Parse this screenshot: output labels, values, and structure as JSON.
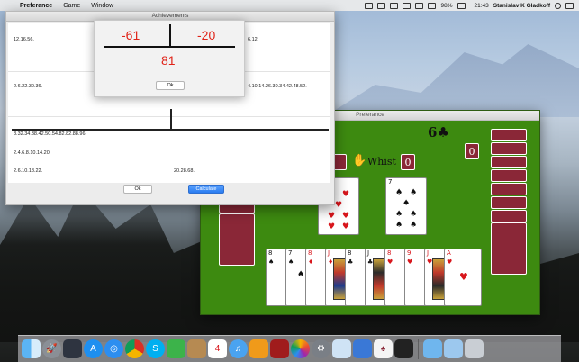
{
  "menubar": {
    "apple": "",
    "app_name": "Preferance",
    "items": [
      "Game",
      "Window"
    ],
    "battery": "98%",
    "flag": "",
    "time": "21:43",
    "user": "Stanislav K Gladkoff"
  },
  "achievements": {
    "title": "Achievements",
    "rows": [
      {
        "left": "12.16.56.",
        "right": "6.12."
      },
      {
        "left": "2.6.22.30.36.",
        "right": "4.10.14.26.30.34.42.48.52."
      },
      {
        "left": "8.32.34.38.42.50.54.82.82.88.96.",
        "right": ""
      },
      {
        "left": "2.4.6.8.10.14.20.",
        "right": ""
      },
      {
        "left": "2.6.10.18.22.",
        "right": "20.28.68."
      }
    ],
    "ok_label": "Ok",
    "calculate_label": "Calculate"
  },
  "score_popup": {
    "left": "-61",
    "right": "-20",
    "total": "81",
    "ok_label": "Ok"
  },
  "game": {
    "title": "Preferance",
    "contract": "6♣",
    "whist_label": "Whist",
    "left_badge": "0",
    "right_badge": "0",
    "suit_colors": {
      "red": "#d8161c",
      "black": "#111111"
    },
    "table_color": "#3d8a10",
    "back_color": "#8a2737",
    "trick_cards": [
      {
        "rank": "7",
        "suit": "♥",
        "color": "red"
      },
      {
        "rank": "7",
        "suit": "♠",
        "color": "black"
      }
    ],
    "hand": [
      {
        "rank": "8",
        "suit": "♠",
        "color": "black"
      },
      {
        "rank": "7",
        "suit": "♠",
        "color": "black"
      },
      {
        "rank": "8",
        "suit": "♦",
        "color": "red"
      },
      {
        "rank": "J",
        "suit": "♦",
        "color": "red"
      },
      {
        "rank": "8",
        "suit": "♣",
        "color": "black"
      },
      {
        "rank": "J",
        "suit": "♣",
        "color": "black"
      },
      {
        "rank": "8",
        "suit": "♥",
        "color": "red"
      },
      {
        "rank": "9",
        "suit": "♥",
        "color": "red"
      },
      {
        "rank": "J",
        "suit": "♥",
        "color": "red"
      },
      {
        "rank": "A",
        "suit": "♥",
        "color": "red"
      }
    ]
  },
  "dock": {
    "icons": [
      "finder-icon",
      "launchpad-icon",
      "mission-control-icon",
      "app-store-icon",
      "safari-icon",
      "chrome-icon",
      "skype-icon",
      "facetime-icon",
      "notes-icon",
      "calendar-icon",
      "itunes-icon",
      "ibooks-icon",
      "photo-booth-icon",
      "photos-icon",
      "system-preferences-icon",
      "preview-icon",
      "xcode-icon",
      "preferance-icon",
      "terminal-icon",
      "folder-icon",
      "downloads-icon",
      "trash-icon"
    ],
    "calendar_day": "4"
  }
}
